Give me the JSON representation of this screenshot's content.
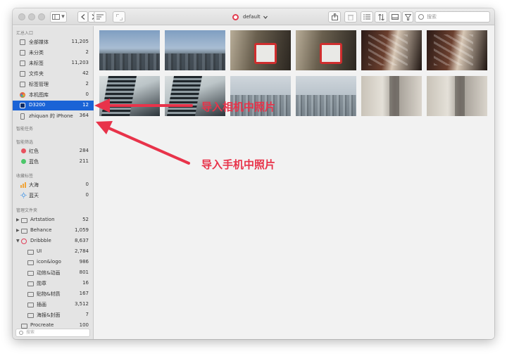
{
  "window": {
    "title": "default",
    "search_placeholder": "搜索",
    "view_toggle_label": "▾",
    "back_icon": "chevron-left-icon",
    "forward_icon": "chevron-right-icon"
  },
  "sidebar": {
    "section_summary": "汇总入口",
    "summary_items": [
      {
        "label": "全部媒体",
        "count": "11,205"
      },
      {
        "label": "未分类",
        "count": "2"
      },
      {
        "label": "未标签",
        "count": "11,203"
      },
      {
        "label": "文件夹",
        "count": "42"
      },
      {
        "label": "标签管理",
        "count": "2"
      },
      {
        "label": "本机图库",
        "count": "0"
      },
      {
        "label": "D3200",
        "count": "12"
      },
      {
        "label": "zhiquan 的 iPhone",
        "count": "364"
      }
    ],
    "section_smart_tasks": "智能任务",
    "section_smart_filter": "智能筛选",
    "filter_items": [
      {
        "label": "红色",
        "count": "284",
        "color": "#e8525f"
      },
      {
        "label": "蓝色",
        "count": "211",
        "color": "#4cc76a"
      }
    ],
    "section_favorites": "收藏标签",
    "favorite_items": [
      {
        "label": "大海",
        "count": "0"
      },
      {
        "label": "蓝天",
        "count": "0"
      }
    ],
    "section_folders": "管理文件夹",
    "folder_items": [
      {
        "label": "Artstation",
        "count": "52"
      },
      {
        "label": "Behance",
        "count": "1,059"
      },
      {
        "label": "Dribbble",
        "count": "8,637"
      },
      {
        "label": "UI",
        "count": "2,784"
      },
      {
        "label": "icon&logo",
        "count": "986"
      },
      {
        "label": "动效&动画",
        "count": "801"
      },
      {
        "label": "勋章",
        "count": "16"
      },
      {
        "label": "贴物&材质",
        "count": "167"
      },
      {
        "label": "插画",
        "count": "3,512"
      },
      {
        "label": "海报&封面",
        "count": "7"
      },
      {
        "label": "Procreate",
        "count": "100"
      }
    ],
    "search_placeholder": "搜索"
  },
  "annotations": {
    "camera_import": "导入相机中照片",
    "phone_import": "导入手机中照片",
    "color": "#e8334a"
  },
  "accent_color": "#1a63d6"
}
